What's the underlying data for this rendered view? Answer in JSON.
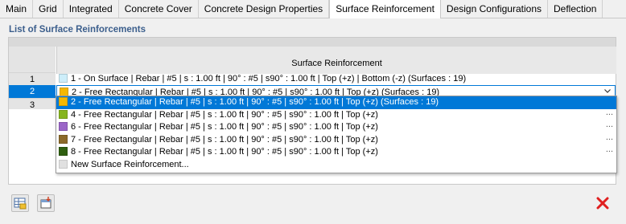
{
  "tabs": [
    {
      "label": "Main",
      "active": false
    },
    {
      "label": "Grid",
      "active": false
    },
    {
      "label": "Integrated",
      "active": false
    },
    {
      "label": "Concrete Cover",
      "active": false
    },
    {
      "label": "Concrete Design Properties",
      "active": false
    },
    {
      "label": "Surface Reinforcement",
      "active": true
    },
    {
      "label": "Design Configurations",
      "active": false
    },
    {
      "label": "Deflection",
      "active": false
    }
  ],
  "section_title": "List of Surface Reinforcements",
  "table": {
    "column_header": "Surface Reinforcement",
    "row_numbers": [
      "1",
      "2",
      "3"
    ],
    "row1_text": "1 - On Surface | Rebar | #5 | s : 1.00 ft | 90° : #5 | s90° : 1.00 ft | Top (+z) | Bottom (-z) (Surfaces : 19)",
    "row2_text": "2 - Free Rectangular | Rebar | #5 | s : 1.00 ft | 90° : #5 | s90° : 1.00 ft | Top (+z) (Surfaces : 19)"
  },
  "dropdown_options": [
    {
      "text": "2 - Free Rectangular | Rebar | #5 | s : 1.00 ft | 90° : #5 | s90° : 1.00 ft | Top (+z) (Surfaces : 19)",
      "color": "#f5b800",
      "highlighted": true,
      "has_more": false
    },
    {
      "text": "4 - Free Rectangular | Rebar | #5 | s : 1.00 ft | 90° : #5 | s90° : 1.00 ft | Top (+z)",
      "color": "#86b51e",
      "highlighted": false,
      "has_more": true
    },
    {
      "text": "6 - Free Rectangular | Rebar | #5 | s : 1.00 ft | 90° : #5 | s90° : 1.00 ft | Top (+z)",
      "color": "#9b66c8",
      "highlighted": false,
      "has_more": true
    },
    {
      "text": "7 - Free Rectangular | Rebar | #5 | s : 1.00 ft | 90° : #5 | s90° : 1.00 ft | Top (+z)",
      "color": "#8c6a2a",
      "highlighted": false,
      "has_more": true
    },
    {
      "text": "8 - Free Rectangular | Rebar | #5 | s : 1.00 ft | 90° : #5 | s90° : 1.00 ft | Top (+z)",
      "color": "#2f5f10",
      "highlighted": false,
      "has_more": true
    },
    {
      "text": "New Surface Reinforcement...",
      "color": "#e0e0e0",
      "highlighted": false,
      "has_more": false
    }
  ],
  "more_label": "...",
  "colors": {
    "row1_swatch": "#cdeefa",
    "row2_swatch": "#f5b800",
    "selection": "#0078d7",
    "section_title": "#3b5e8c",
    "close": "#e02020"
  },
  "icons": {
    "chevron": "chevron-down-icon",
    "toolbar_left": "grid-table-icon",
    "toolbar_second": "import-icon",
    "close": "close-icon"
  }
}
